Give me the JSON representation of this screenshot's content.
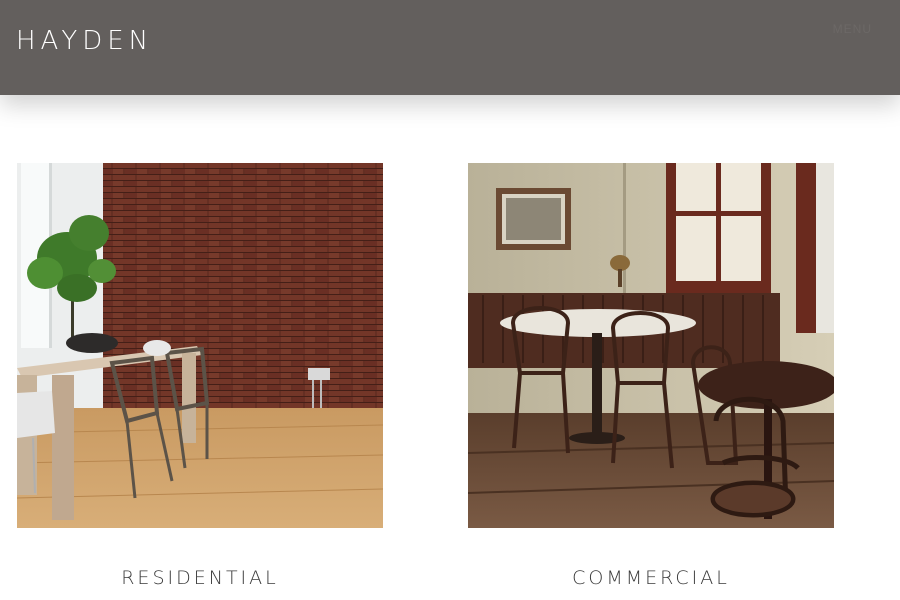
{
  "header": {
    "logo": "HAYDEN",
    "nav_hint": "MENU"
  },
  "categories": [
    {
      "label": "RESIDENTIAL",
      "image": "dining-room-brick-wall-photo"
    },
    {
      "label": "COMMERCIAL",
      "image": "cafe-interior-banquette-photo"
    }
  ],
  "colors": {
    "header_bg": "#635f5d",
    "logo_text": "#ffffff",
    "caption_text": "#3a3a3a"
  }
}
